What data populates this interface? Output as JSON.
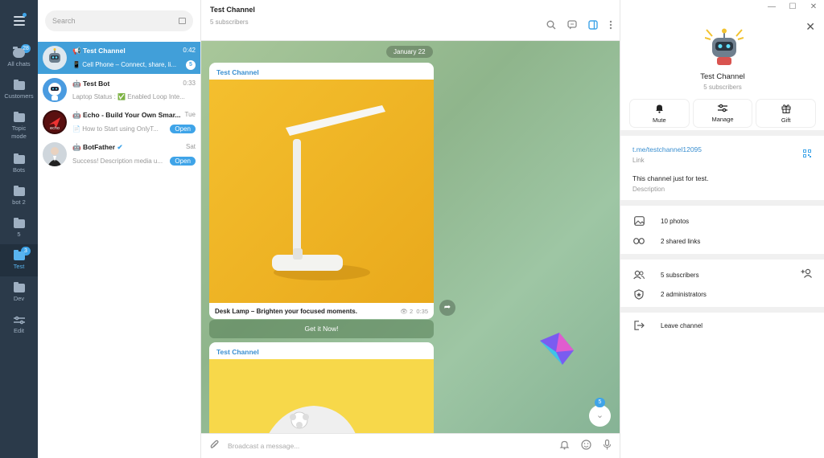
{
  "window": {
    "minimize": "—",
    "maximize": "☐",
    "close": "✕"
  },
  "rail": {
    "folders": [
      {
        "label": "All chats",
        "badge": "28"
      },
      {
        "label": "Customers",
        "badge": ""
      },
      {
        "label": "Topic mode",
        "badge": ""
      },
      {
        "label": "Bots",
        "badge": ""
      },
      {
        "label": "bot 2",
        "badge": ""
      },
      {
        "label": "5",
        "badge": ""
      },
      {
        "label": "Test",
        "badge": "3"
      },
      {
        "label": "Dev",
        "badge": ""
      },
      {
        "label": "Edit",
        "badge": ""
      }
    ]
  },
  "search": {
    "placeholder": "Search"
  },
  "chats": [
    {
      "name": "Test Channel",
      "time": "0:42",
      "preview": "Cell Phone – Connect, share, li...",
      "count": "5",
      "pill": ""
    },
    {
      "name": "Test Bot",
      "time": "0:33",
      "preview": "Laptop Status : ✅ Enabled Loop Inte...",
      "count": "",
      "pill": ""
    },
    {
      "name": "Echo - Build Your Own Smar...",
      "time": "Tue",
      "preview": "How to Start using OnlyT...",
      "count": "",
      "pill": "Open"
    },
    {
      "name": "BotFather",
      "time": "Sat",
      "preview": "Success! Description media u...",
      "count": "",
      "pill": "Open"
    }
  ],
  "header": {
    "title": "Test Channel",
    "subtitle": "5 subscribers"
  },
  "feed": {
    "date": "January 22",
    "post1": {
      "channel": "Test Channel",
      "caption": "Desk Lamp – Brighten your focused moments.",
      "views": "2",
      "time": "0:35",
      "button": "Get it Now!"
    },
    "post2": {
      "channel": "Test Channel"
    },
    "unread": "5"
  },
  "compose": {
    "placeholder": "Broadcast a message..."
  },
  "info": {
    "title": "Test Channel",
    "subtitle": "5 subscribers",
    "actions": [
      "Mute",
      "Manage",
      "Gift"
    ],
    "link": "t.me/testchannel12095",
    "link_label": "Link",
    "description": "This channel just for test.",
    "description_label": "Description",
    "photos": "10 photos",
    "shared_links": "2 shared links",
    "subscribers": "5 subscribers",
    "administrators": "2 administrators",
    "leave": "Leave channel"
  },
  "colors": {
    "accent": "#419fd9",
    "rail": "#2b3a4a",
    "chat_bg": "#9ec6a4",
    "photo": "#f2b82b"
  }
}
